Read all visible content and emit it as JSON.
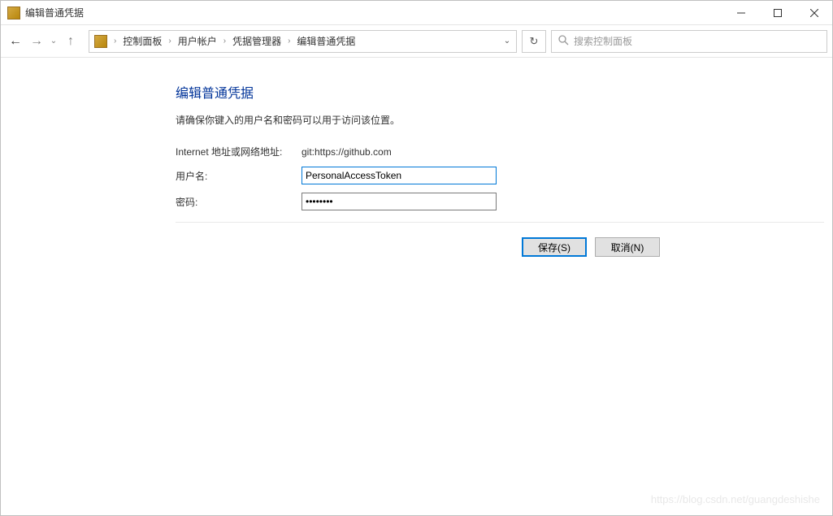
{
  "window": {
    "title": "编辑普通凭据"
  },
  "breadcrumb": {
    "items": [
      "控制面板",
      "用户帐户",
      "凭据管理器",
      "编辑普通凭据"
    ]
  },
  "search": {
    "placeholder": "搜索控制面板"
  },
  "page": {
    "heading": "编辑普通凭据",
    "description": "请确保你键入的用户名和密码可以用于访问该位置。"
  },
  "form": {
    "address_label": "Internet 地址或网络地址:",
    "address_value": "git:https://github.com",
    "username_label": "用户名:",
    "username_value": "PersonalAccessToken",
    "password_label": "密码:",
    "password_value": "••••••••"
  },
  "buttons": {
    "save": "保存(S)",
    "cancel": "取消(N)"
  },
  "watermark": "https://blog.csdn.net/guangdeshishe"
}
